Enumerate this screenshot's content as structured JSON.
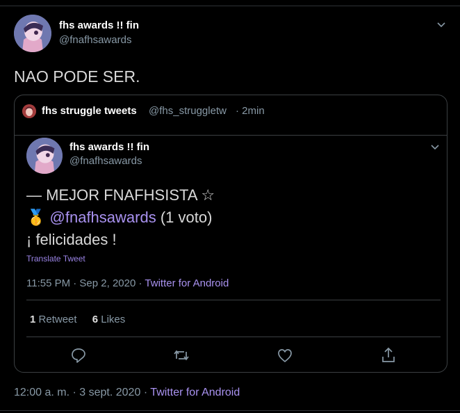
{
  "tweet": {
    "author_name": "fhs awards !! fin",
    "author_handle": "@fnafhsawards",
    "text": "NAO PODE SER.",
    "footer": {
      "time": "12:00 a. m.",
      "sep": "·",
      "date": "3 sept. 2020",
      "sep2": "·",
      "source": "Twitter for Android"
    }
  },
  "quote": {
    "header_name": "fhs struggle tweets",
    "header_handle": "@fhs_struggletw",
    "header_time": "· 2min",
    "embedded": {
      "author_name": "fhs awards !! fin",
      "author_handle": "@fnafhsawards",
      "line1": "— MEJOR FNAFHSISTA ☆",
      "medal": "🥇",
      "mention": "@fnafhsawards",
      "vote": "(1 voto)",
      "line3": "¡ felicidades !",
      "translate": "Translate Tweet",
      "time": "11:55 PM · Sep 2, 2020 ·",
      "source": "Twitter for Android",
      "retweets_count": "1",
      "retweets_label": "Retweet",
      "likes_count": "6",
      "likes_label": "Likes"
    }
  },
  "icons": {
    "more": "chevron-down-icon",
    "reply": "reply-icon",
    "retweet": "retweet-icon",
    "like": "heart-icon",
    "share": "share-icon"
  },
  "colors": {
    "background": "#000000",
    "link": "#a992f0",
    "muted": "#8899a6",
    "border": "#3c4043"
  }
}
